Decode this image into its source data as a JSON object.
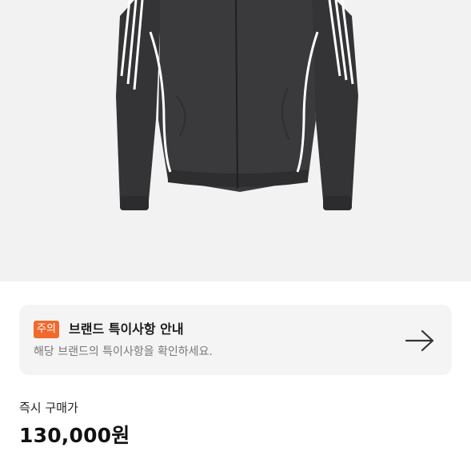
{
  "notice": {
    "badge": "주의",
    "title": "브랜드 특이사항 안내",
    "description": "해당 브랜드의 특이사항을 확인하세요.",
    "arrow_icon": "arrow-right-icon",
    "badge_color": "#ef6a2b"
  },
  "price": {
    "label": "즉시 구매가",
    "value": "130,000원"
  },
  "colors": {
    "image_background": "#f2f2f2",
    "card_background": "#f4f4f4",
    "jacket": "#3a3a3c"
  }
}
